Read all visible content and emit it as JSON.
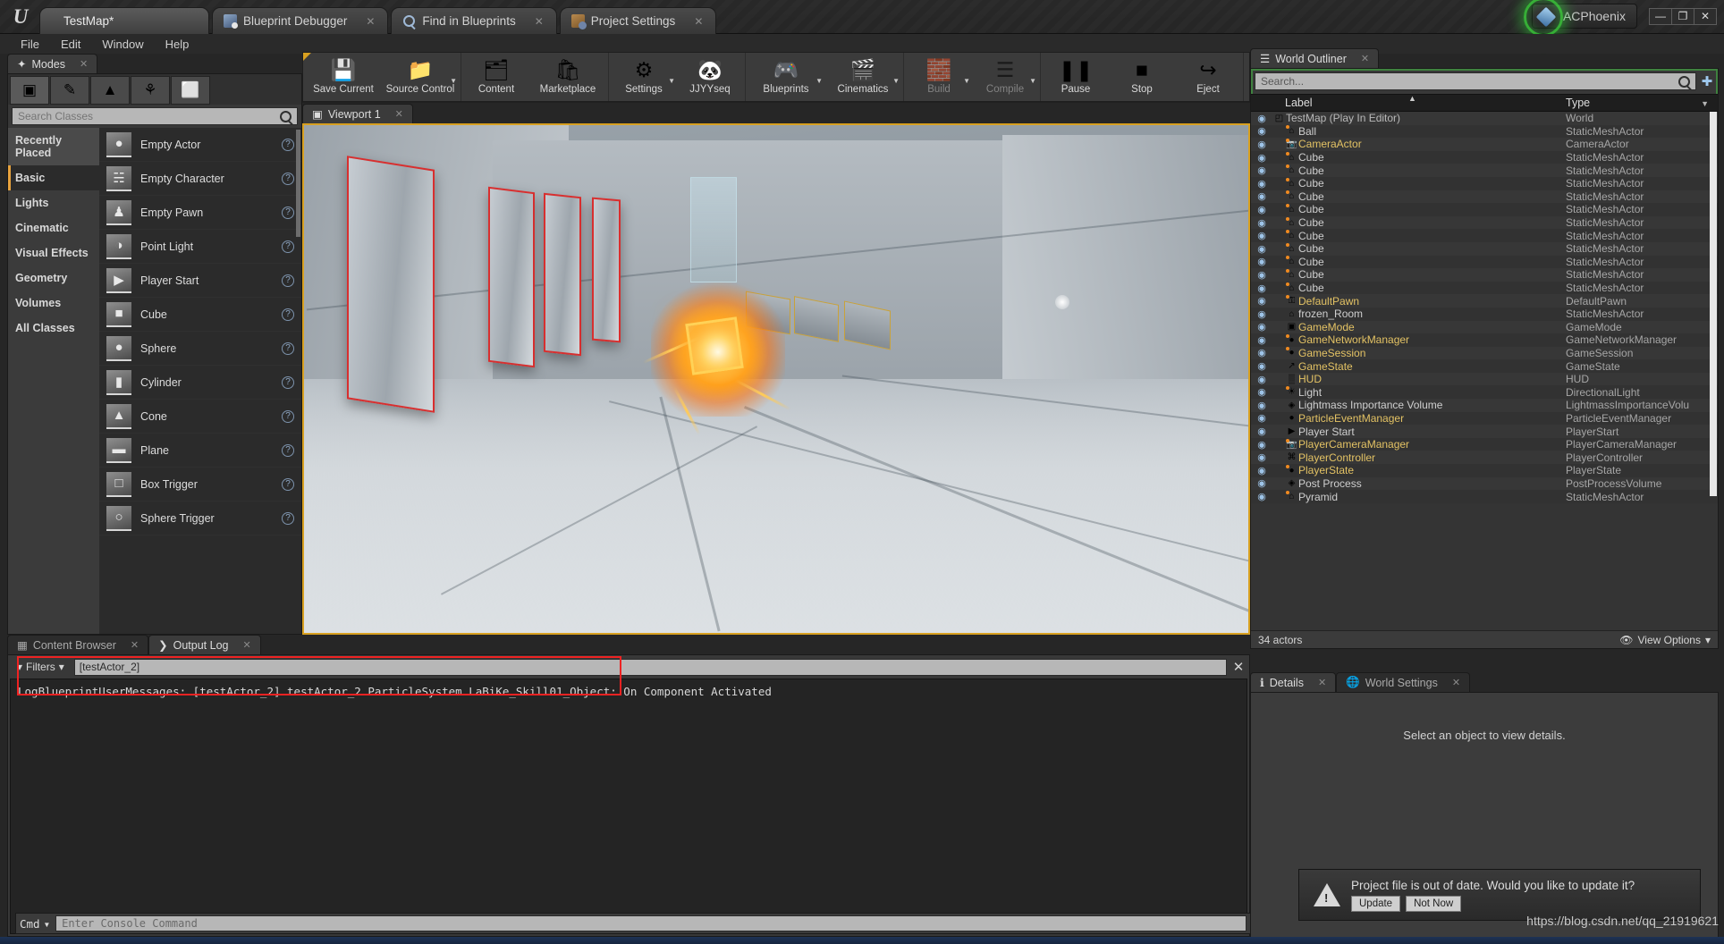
{
  "window": {
    "tabs": [
      {
        "label": "TestMap*",
        "icon": "unreal-logo-icon",
        "active": true,
        "closable": false
      },
      {
        "label": "Blueprint Debugger",
        "icon": "blueprint-debugger-icon",
        "active": false,
        "closable": true
      },
      {
        "label": "Find in Blueprints",
        "icon": "find-icon",
        "active": false,
        "closable": true
      },
      {
        "label": "Project Settings",
        "icon": "project-settings-icon",
        "active": false,
        "closable": true
      }
    ],
    "account_name": "ACPhoenix",
    "minimize": "—",
    "restore": "❐",
    "close": "✕"
  },
  "menubar": {
    "items": [
      "File",
      "Edit",
      "Window",
      "Help"
    ]
  },
  "toolbar": {
    "groups": [
      {
        "items": [
          {
            "label": "Save Current",
            "icon": "floppy-disk-icon",
            "caret": false,
            "disabled": false
          },
          {
            "label": "Source Control",
            "icon": "source-control-icon",
            "caret": true,
            "disabled": false
          }
        ]
      },
      {
        "items": [
          {
            "label": "Content",
            "icon": "content-browser-icon",
            "caret": false,
            "disabled": false
          },
          {
            "label": "Marketplace",
            "icon": "marketplace-bag-icon",
            "caret": false,
            "disabled": false
          }
        ]
      },
      {
        "items": [
          {
            "label": "Settings",
            "icon": "gear-icon",
            "caret": true,
            "disabled": false
          },
          {
            "label": "JJYYseq",
            "icon": "panda-face-icon",
            "caret": false,
            "disabled": false
          }
        ]
      },
      {
        "items": [
          {
            "label": "Blueprints",
            "icon": "blueprints-icon",
            "caret": true,
            "disabled": false
          },
          {
            "label": "Cinematics",
            "icon": "clapperboard-icon",
            "caret": true,
            "disabled": false
          }
        ]
      },
      {
        "items": [
          {
            "label": "Build",
            "icon": "build-blocks-icon",
            "caret": true,
            "disabled": true
          },
          {
            "label": "Compile",
            "icon": "compile-cubes-icon",
            "caret": true,
            "disabled": true
          }
        ]
      },
      {
        "items": [
          {
            "label": "Pause",
            "icon": "pause-icon",
            "caret": false,
            "disabled": false
          },
          {
            "label": "Stop",
            "icon": "stop-icon",
            "caret": false,
            "disabled": false
          },
          {
            "label": "Eject",
            "icon": "eject-person-icon",
            "caret": false,
            "disabled": false
          }
        ]
      }
    ]
  },
  "modes": {
    "tab_label": "Modes",
    "tab_icon": "modes-icon",
    "mode_buttons": [
      {
        "name": "place-mode",
        "glyph": "▣",
        "selected": true
      },
      {
        "name": "paint-mode",
        "glyph": "✎",
        "selected": false
      },
      {
        "name": "landscape-mode",
        "glyph": "▲",
        "selected": false
      },
      {
        "name": "foliage-mode",
        "glyph": "⚘",
        "selected": false
      },
      {
        "name": "geometry-edit-mode",
        "glyph": "⬜",
        "selected": false
      }
    ],
    "search_placeholder": "Search Classes",
    "search_value": "",
    "categories": [
      {
        "label": "Recently Placed",
        "state": "hl"
      },
      {
        "label": "Basic",
        "state": "sel"
      },
      {
        "label": "Lights",
        "state": ""
      },
      {
        "label": "Cinematic",
        "state": ""
      },
      {
        "label": "Visual Effects",
        "state": ""
      },
      {
        "label": "Geometry",
        "state": ""
      },
      {
        "label": "Volumes",
        "state": ""
      },
      {
        "label": "All Classes",
        "state": ""
      }
    ],
    "actors": [
      {
        "label": "Empty Actor",
        "glyph": "●"
      },
      {
        "label": "Empty Character",
        "glyph": "☵"
      },
      {
        "label": "Empty Pawn",
        "glyph": "♟"
      },
      {
        "label": "Point Light",
        "glyph": "◑"
      },
      {
        "label": "Player Start",
        "glyph": "▶"
      },
      {
        "label": "Cube",
        "glyph": "■"
      },
      {
        "label": "Sphere",
        "glyph": "●"
      },
      {
        "label": "Cylinder",
        "glyph": "▮"
      },
      {
        "label": "Cone",
        "glyph": "▲"
      },
      {
        "label": "Plane",
        "glyph": "▬"
      },
      {
        "label": "Box Trigger",
        "glyph": "□"
      },
      {
        "label": "Sphere Trigger",
        "glyph": "○"
      }
    ],
    "help_glyph": "?"
  },
  "viewport": {
    "tab_label": "Viewport 1",
    "tab_icon": "viewport-icon"
  },
  "bottom_panel": {
    "tabs": [
      {
        "label": "Content Browser",
        "icon": "content-browser-icon",
        "active": false
      },
      {
        "label": "Output Log",
        "icon": "output-log-icon",
        "active": true
      }
    ],
    "filters_label": "Filters",
    "filter_value": "[testActor_2]",
    "close_glyph": "✕",
    "log_lines": [
      "LogBlueprintUserMessages: [testActor_2] testActor_2.ParticleSystem LaBiKe_Skill01_Object: On Component Activated"
    ],
    "cmd_label": "Cmd",
    "cmd_placeholder": "Enter Console Command"
  },
  "outliner": {
    "tab_label": "World Outliner",
    "tab_icon": "world-outliner-icon",
    "search_placeholder": "Search...",
    "search_value": "",
    "col_label": "Label",
    "col_type": "Type",
    "rows": [
      {
        "label": "TestMap (Play In Editor)",
        "type": "World",
        "hl": false,
        "root": true,
        "icon": "world-icon",
        "dot": false
      },
      {
        "label": "Ball",
        "type": "StaticMeshActor",
        "hl": false,
        "icon": "mesh-icon",
        "dot": true
      },
      {
        "label": "CameraActor",
        "type": "CameraActor",
        "hl": true,
        "icon": "camera-icon",
        "dot": true
      },
      {
        "label": "Cube",
        "type": "StaticMeshActor",
        "hl": false,
        "icon": "mesh-icon",
        "dot": true
      },
      {
        "label": "Cube",
        "type": "StaticMeshActor",
        "hl": false,
        "icon": "mesh-icon",
        "dot": true
      },
      {
        "label": "Cube",
        "type": "StaticMeshActor",
        "hl": false,
        "icon": "mesh-icon",
        "dot": true
      },
      {
        "label": "Cube",
        "type": "StaticMeshActor",
        "hl": false,
        "icon": "mesh-icon",
        "dot": true
      },
      {
        "label": "Cube",
        "type": "StaticMeshActor",
        "hl": false,
        "icon": "mesh-icon",
        "dot": true
      },
      {
        "label": "Cube",
        "type": "StaticMeshActor",
        "hl": false,
        "icon": "mesh-icon",
        "dot": true
      },
      {
        "label": "Cube",
        "type": "StaticMeshActor",
        "hl": false,
        "icon": "mesh-icon",
        "dot": true
      },
      {
        "label": "Cube",
        "type": "StaticMeshActor",
        "hl": false,
        "icon": "mesh-icon",
        "dot": true
      },
      {
        "label": "Cube",
        "type": "StaticMeshActor",
        "hl": false,
        "icon": "mesh-icon",
        "dot": true
      },
      {
        "label": "Cube",
        "type": "StaticMeshActor",
        "hl": false,
        "icon": "mesh-icon",
        "dot": true
      },
      {
        "label": "Cube",
        "type": "StaticMeshActor",
        "hl": false,
        "icon": "mesh-icon",
        "dot": true
      },
      {
        "label": "DefaultPawn",
        "type": "DefaultPawn",
        "hl": true,
        "icon": "pawn-icon",
        "dot": true
      },
      {
        "label": "frozen_Room",
        "type": "StaticMeshActor",
        "hl": false,
        "icon": "mesh-icon",
        "dot": false
      },
      {
        "label": "GameMode",
        "type": "GameMode",
        "hl": true,
        "icon": "gamemode-icon",
        "dot": false
      },
      {
        "label": "GameNetworkManager",
        "type": "GameNetworkManager",
        "hl": true,
        "icon": "sphere-icon",
        "dot": true
      },
      {
        "label": "GameSession",
        "type": "GameSession",
        "hl": true,
        "icon": "sphere-icon",
        "dot": true
      },
      {
        "label": "GameState",
        "type": "GameState",
        "hl": true,
        "icon": "gamestate-icon",
        "dot": false
      },
      {
        "label": "HUD",
        "type": "HUD",
        "hl": true,
        "icon": "hud-icon",
        "dot": false
      },
      {
        "label": "Light",
        "type": "DirectionalLight",
        "hl": false,
        "icon": "light-icon",
        "dot": true
      },
      {
        "label": "Lightmass Importance Volume",
        "type": "LightmassImportanceVolu",
        "hl": false,
        "icon": "volume-icon",
        "dot": false
      },
      {
        "label": "ParticleEventManager",
        "type": "ParticleEventManager",
        "hl": true,
        "icon": "sphere-icon",
        "dot": false
      },
      {
        "label": "Player Start",
        "type": "PlayerStart",
        "hl": false,
        "icon": "playerstart-icon",
        "dot": false
      },
      {
        "label": "PlayerCameraManager",
        "type": "PlayerCameraManager",
        "hl": true,
        "icon": "camera-icon",
        "dot": true
      },
      {
        "label": "PlayerController",
        "type": "PlayerController",
        "hl": true,
        "icon": "controller-icon",
        "dot": false
      },
      {
        "label": "PlayerState",
        "type": "PlayerState",
        "hl": true,
        "icon": "sphere-icon",
        "dot": true
      },
      {
        "label": "Post Process",
        "type": "PostProcessVolume",
        "hl": false,
        "icon": "volume-icon",
        "dot": false
      },
      {
        "label": "Pyramid",
        "type": "StaticMeshActor",
        "hl": false,
        "icon": "mesh-icon",
        "dot": true
      }
    ],
    "footer_count": "34 actors",
    "view_options": "View Options"
  },
  "details": {
    "tabs": [
      {
        "label": "Details",
        "icon": "details-icon",
        "active": true
      },
      {
        "label": "World Settings",
        "icon": "world-settings-icon",
        "active": false
      }
    ],
    "empty_message": "Select an object to view details."
  },
  "notification": {
    "message": "Project file is out of date. Would you like to update it?",
    "update_label": "Update",
    "not_now_label": "Not Now",
    "icon": "warning-triangle-icon"
  },
  "watermark": "https://blog.csdn.net/qq_21919621",
  "colors": {
    "accent_orange": "#e8a33d",
    "viewport_border": "#d8a020",
    "highlight_yellow": "#e3c264",
    "error_red": "#ee2222",
    "glow_green": "#3cdc3c"
  }
}
